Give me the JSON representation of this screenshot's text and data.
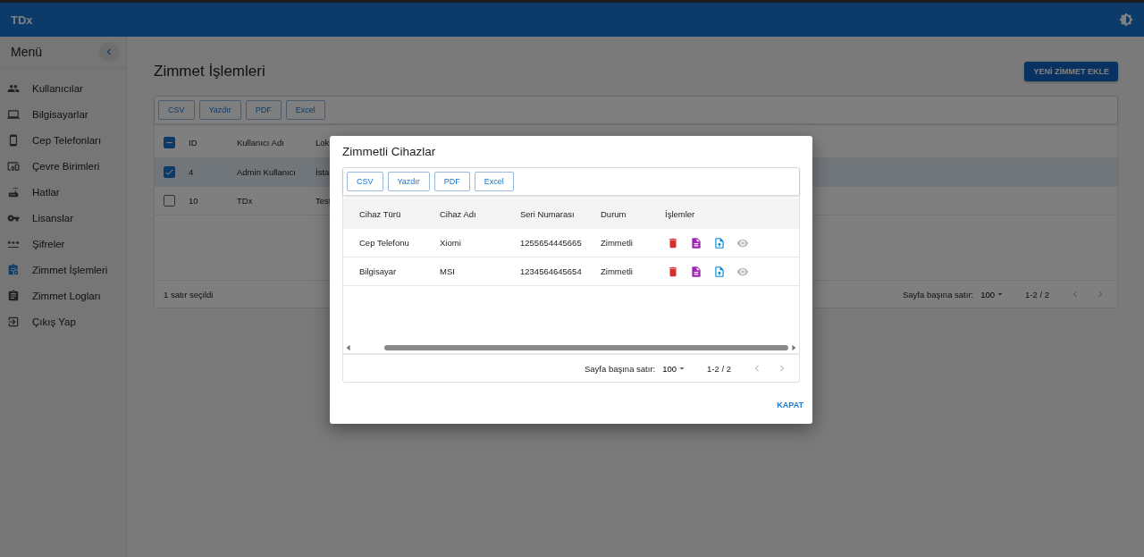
{
  "app_bar": {
    "title": "TDx"
  },
  "sidebar": {
    "title": "Menü",
    "items": [
      {
        "label": "Kullanıcılar",
        "selected": false
      },
      {
        "label": "Bilgisayarlar",
        "selected": false
      },
      {
        "label": "Cep Telefonları",
        "selected": false
      },
      {
        "label": "Çevre Birimleri",
        "selected": false
      },
      {
        "label": "Hatlar",
        "selected": false
      },
      {
        "label": "Lisanslar",
        "selected": false
      },
      {
        "label": "Şifreler",
        "selected": false
      },
      {
        "label": "Zimmet İşlemleri",
        "selected": true
      },
      {
        "label": "Zimmet Logları",
        "selected": false
      },
      {
        "label": "Çıkış Yap",
        "selected": false
      }
    ]
  },
  "page": {
    "title": "Zimmet İşlemleri",
    "add_button": "YENİ ZİMMET EKLE",
    "export_buttons": [
      "CSV",
      "Yazdır",
      "PDF",
      "Excel"
    ],
    "table": {
      "select_all": {
        "indeterminate": true
      },
      "columns": [
        "ID",
        "Kullanıcı Adı",
        "Lok"
      ],
      "rows": [
        {
          "cells": [
            "4",
            "Admin Kullanıcı",
            "İsta"
          ],
          "selected": true
        },
        {
          "cells": [
            "10",
            "TDx",
            "Test"
          ],
          "selected": false
        }
      ]
    },
    "footer": {
      "selection": "1 satır seçildi",
      "rows_per_page_label": "Sayfa başına satır:",
      "rows_per_page": "100",
      "range": "1-2 / 2"
    }
  },
  "dialog": {
    "title": "Zimmetli Cihazlar",
    "export_buttons": [
      "CSV",
      "Yazdır",
      "PDF",
      "Excel"
    ],
    "table": {
      "columns": [
        "Cihaz Türü",
        "Cihaz Adı",
        "Seri Numarası",
        "Durum",
        "İşlemler"
      ],
      "rows": [
        {
          "cells": [
            "Cep Telefonu",
            "Xiomi",
            "1255654445665",
            "Zimmetli"
          ]
        },
        {
          "cells": [
            "Bilgisayar",
            "MSI",
            "1234564645654",
            "Zimmetli"
          ]
        }
      ]
    },
    "footer": {
      "rows_per_page_label": "Sayfa başına satır:",
      "rows_per_page": "100",
      "range": "1-2 / 2"
    },
    "close_button": "KAPAT"
  }
}
